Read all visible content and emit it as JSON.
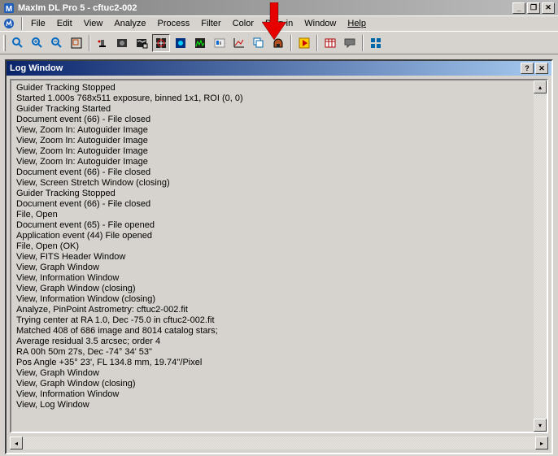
{
  "titlebar": {
    "title": "MaxIm DL Pro 5 - cftuc2-002",
    "minimize": "_",
    "maximize": "❐",
    "close": "✕"
  },
  "menubar": {
    "items": [
      "File",
      "Edit",
      "View",
      "Analyze",
      "Process",
      "Filter",
      "Color",
      "Plug-in",
      "Window",
      "Help"
    ]
  },
  "toolbar_icons": [
    "zoom-fit-icon",
    "zoom-in-icon",
    "zoom-out-icon",
    "zoom-frame-icon",
    "sep",
    "camera-telescope-icon",
    "photo-icon",
    "stretch-config-icon",
    "profile-config-icon",
    "autofocus-icon",
    "histogram-icon",
    "pinpoint-icon",
    "graph-icon",
    "cascade-icon",
    "observatory-icon",
    "sep",
    "record-icon",
    "sep",
    "calendar-icon",
    "log-chat-icon",
    "sep",
    "tile-icon"
  ],
  "toolbar_active_idx": 8,
  "logwin": {
    "title": "Log Window",
    "help": "?",
    "close": "✕"
  },
  "log": [
    "Guider Tracking Stopped",
    "Started 1.000s 768x511 exposure, binned 1x1, ROI (0, 0)",
    "Guider Tracking Started",
    "Document event (66) - File closed",
    "View, Zoom In: Autoguider Image",
    "View, Zoom In: Autoguider Image",
    "View, Zoom In: Autoguider Image",
    "View, Zoom In: Autoguider Image",
    "Document event (66) - File closed",
    "View, Screen Stretch Window (closing)",
    "Guider Tracking Stopped",
    "Document event (66) - File closed",
    "File, Open",
    "Document event (65) - File opened",
    "Application event (44) File opened",
    "File, Open (OK)",
    "View, FITS Header Window",
    "View, Graph Window",
    "View, Information Window",
    "View, Graph Window (closing)",
    "View, Information Window (closing)",
    "Analyze, PinPoint Astrometry: cftuc2-002.fit",
    "Trying center at RA 1.0, Dec -75.0 in cftuc2-002.fit",
    "Matched 408 of 686 image and 8014 catalog stars;",
    "Average residual 3.5 arcsec; order 4",
    "RA 00h 50m 27s,  Dec -74° 34' 53\"",
    "Pos Angle +35° 23', FL 134.8 mm, 19.74''/Pixel",
    "View, Graph Window",
    "View, Graph Window (closing)",
    "View, Information Window",
    "View, Log Window"
  ]
}
